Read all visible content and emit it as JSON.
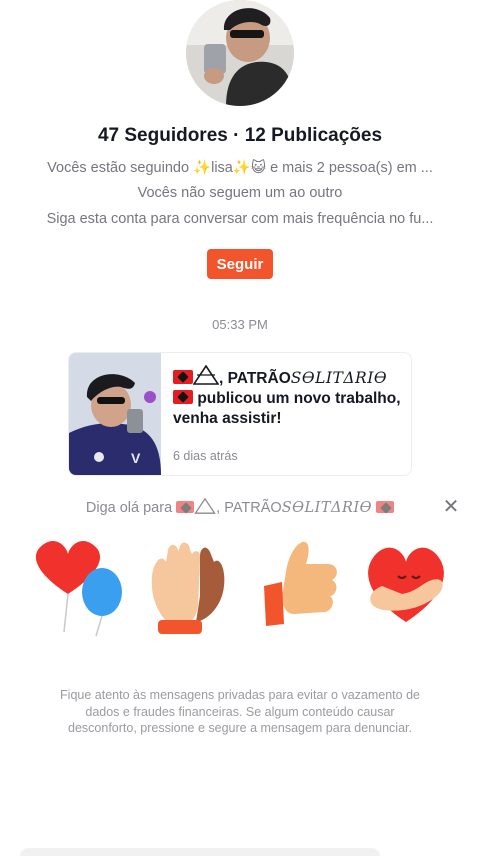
{
  "profile": {
    "stats": "47 Seguidores · 12 Publicações",
    "line1": "Vocês estão seguindo ✨lisa✨😺 e mais 2 pessoa(s) em ...",
    "line2": "Vocês não seguem um ao outro",
    "line3": "Siga esta conta para conversar com mais frequência no fu...",
    "follow_label": "Seguir"
  },
  "chat": {
    "timestamp": "05:33 PM",
    "card": {
      "name_plain": ", PATRÃO",
      "name_script": "SƟLITΔRIƟ",
      "text": "publicou um novo trabalho, venha assistir!",
      "time": "6 dias atrás"
    },
    "hello": {
      "prefix": "Diga olá para",
      "name_plain": ", PATRÃO",
      "name_script": "SƟLITΔRIƟ"
    },
    "stickers": [
      "heart-balloon-sticker",
      "clapping-hands-sticker",
      "thumbs-up-sticker",
      "heart-hug-sticker"
    ],
    "notice": "Fique atento às mensagens privadas para evitar o vazamento de dados e fraudes financeiras. Se algum conteúdo causar desconforto, pressione e segure a mensagem para denunciar."
  },
  "colors": {
    "accent": "#f2552c",
    "text": "#161823",
    "muted": "#75767e"
  }
}
